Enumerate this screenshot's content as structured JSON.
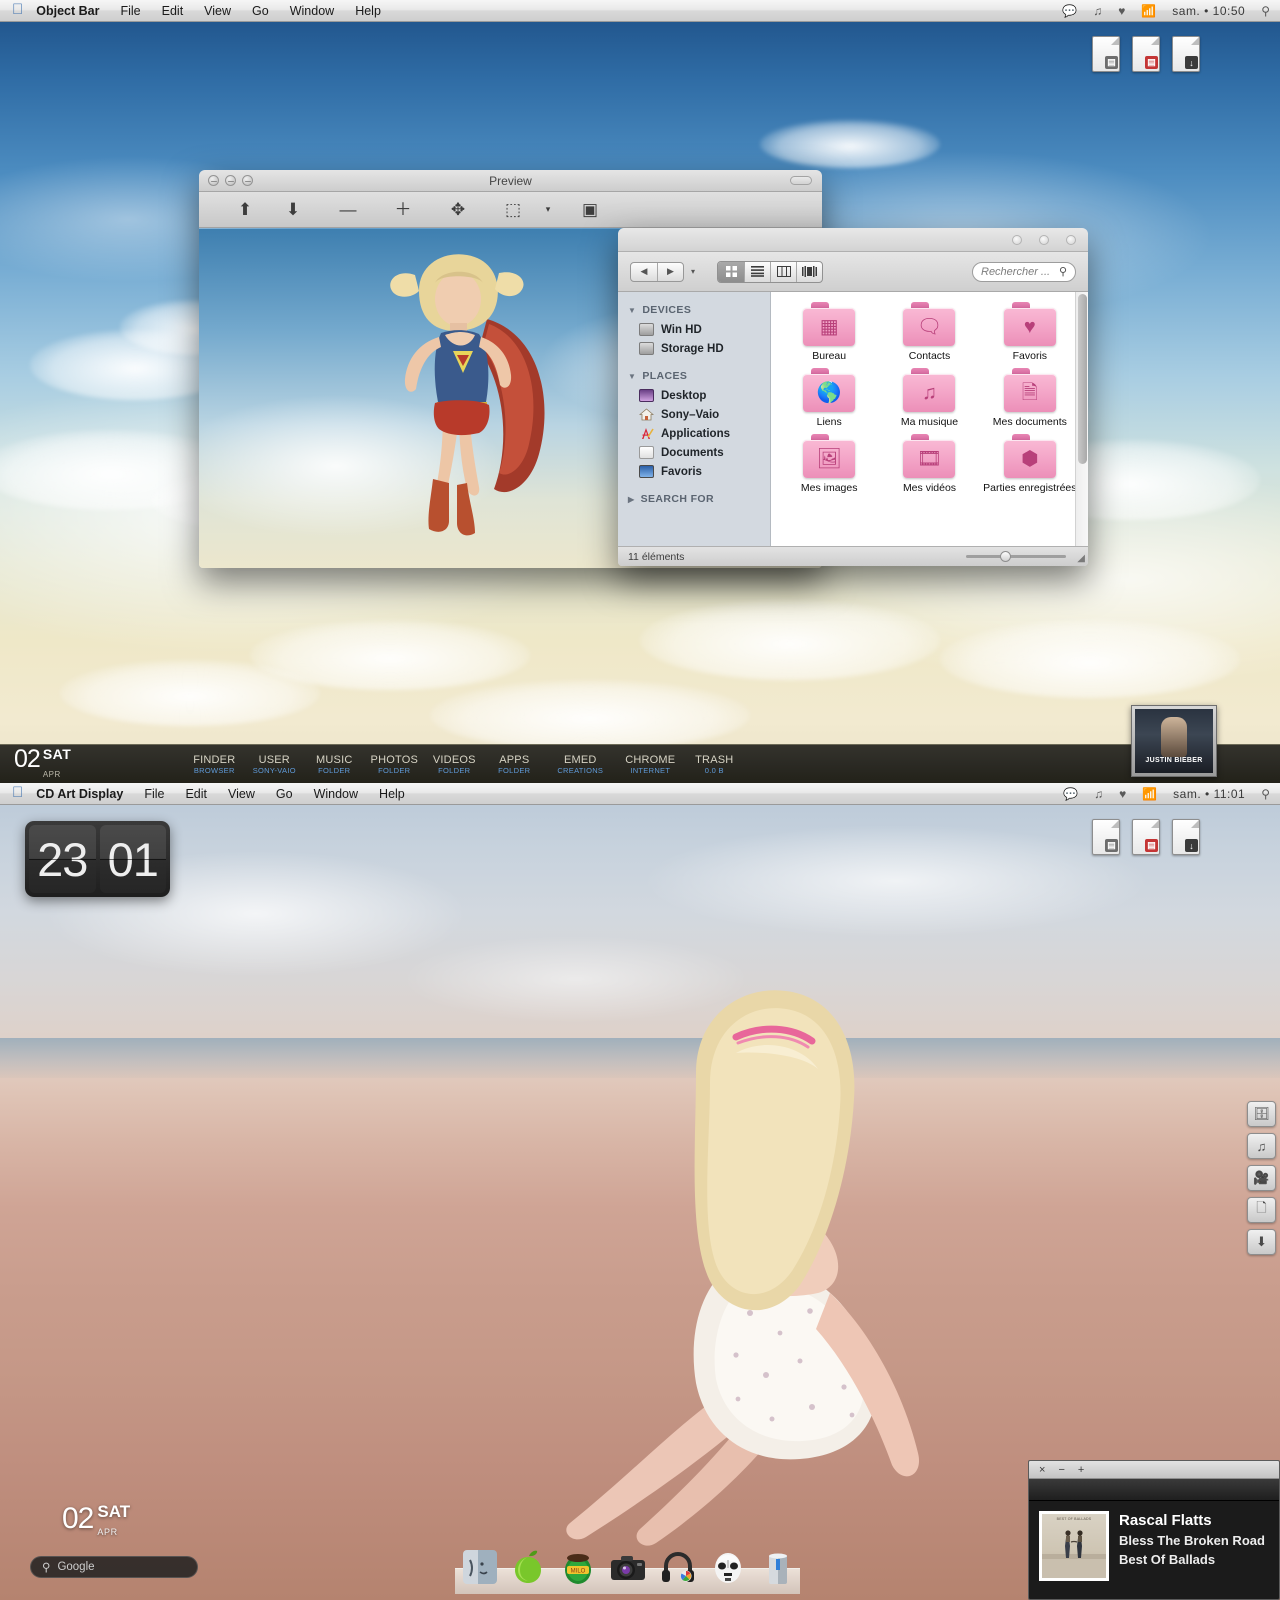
{
  "top_desktop": {
    "menubar": {
      "apple_icon": "apple-icon",
      "app_name": "Object Bar",
      "menus": [
        "File",
        "Edit",
        "View",
        "Go",
        "Window",
        "Help"
      ],
      "status_icons": [
        "speech-bubble-icon",
        "music-note-icon",
        "heart-icon",
        "rss-icon"
      ],
      "day": "sam.",
      "separator": "•",
      "clock": "10:50",
      "spotlight_icon": "search-icon"
    },
    "desktop_icons": [
      {
        "name": "document-icon-1",
        "badge": "▤",
        "badge_color": "#6d6d6d"
      },
      {
        "name": "document-icon-2",
        "badge": "▤",
        "badge_color": "#c43535"
      },
      {
        "name": "document-icon-3",
        "badge": "↓",
        "badge_color": "#3b3b3b"
      }
    ],
    "preview_window": {
      "title": "Preview",
      "toolbar_buttons": [
        {
          "name": "page-up-button",
          "glyph": "⬆"
        },
        {
          "name": "page-down-button",
          "glyph": "⬇"
        },
        {
          "name": "zoom-out-button",
          "glyph": "—"
        },
        {
          "name": "zoom-in-button",
          "glyph": "＋"
        },
        {
          "name": "move-tool-button",
          "glyph": "✥"
        },
        {
          "name": "select-tool-button",
          "glyph": "⬚"
        },
        {
          "name": "select-dropdown-button",
          "glyph": "▾"
        },
        {
          "name": "slideshow-button",
          "glyph": "▣"
        }
      ]
    },
    "finder_window": {
      "nav_back": "◀",
      "nav_forward": "▶",
      "nav_caret": "▾",
      "view_modes": [
        {
          "name": "icon-view-button",
          "glyph": "⠿",
          "active": true
        },
        {
          "name": "list-view-button",
          "glyph": "☰",
          "active": false
        },
        {
          "name": "column-view-button",
          "glyph": "▥",
          "active": false
        },
        {
          "name": "coverflow-view-button",
          "glyph": "|▮|",
          "active": false
        }
      ],
      "search_placeholder": "Rechercher ...",
      "search_icon": "magnifier-icon",
      "sidebar": [
        {
          "header": "DEVICES",
          "expanded": true,
          "items": [
            {
              "label": "Win HD",
              "icon": "harddisk-icon"
            },
            {
              "label": "Storage HD",
              "icon": "harddisk-icon"
            }
          ]
        },
        {
          "header": "PLACES",
          "expanded": true,
          "items": [
            {
              "label": "Desktop",
              "icon": "desktop-icon"
            },
            {
              "label": "Sony–Vaio",
              "icon": "home-icon"
            },
            {
              "label": "Applications",
              "icon": "applications-icon"
            },
            {
              "label": "Documents",
              "icon": "documents-icon"
            },
            {
              "label": "Favoris",
              "icon": "favorites-icon"
            }
          ]
        },
        {
          "header": "SEARCH FOR",
          "expanded": false,
          "items": []
        }
      ],
      "files": [
        {
          "label": "Bureau",
          "icon": "window-folder-icon",
          "glyph": "▤"
        },
        {
          "label": "Contacts",
          "icon": "contacts-folder-icon",
          "glyph": "💬"
        },
        {
          "label": "Favoris",
          "icon": "heart-folder-icon",
          "glyph": "♥"
        },
        {
          "label": "Liens",
          "icon": "globe-folder-icon",
          "glyph": "🌐"
        },
        {
          "label": "Ma musique",
          "icon": "music-folder-icon",
          "glyph": "♫"
        },
        {
          "label": "Mes documents",
          "icon": "document-folder-icon",
          "glyph": "🗎"
        },
        {
          "label": "Mes images",
          "icon": "pictures-folder-icon",
          "glyph": "🖼"
        },
        {
          "label": "Mes vidéos",
          "icon": "video-folder-icon",
          "glyph": "🎞"
        },
        {
          "label": "Parties enregistrées",
          "icon": "saved-games-folder-icon",
          "glyph": "📦"
        }
      ],
      "status": "11 éléments",
      "resize_icon": "resize-grip-icon"
    },
    "objectdock": {
      "date_day_number": "02",
      "date_weekday": "SAT",
      "date_month": "APR",
      "items": [
        {
          "title": "FINDER",
          "subtitle": "BROWSER"
        },
        {
          "title": "USER",
          "subtitle": "SONY-VAIO"
        },
        {
          "title": "MUSIC",
          "subtitle": "FOLDER"
        },
        {
          "title": "PHOTOS",
          "subtitle": "FOLDER"
        },
        {
          "title": "VIDEOS",
          "subtitle": "FOLDER"
        },
        {
          "title": "APPS",
          "subtitle": "FOLDER"
        },
        {
          "title": "EMED",
          "subtitle": "CREATIONS"
        },
        {
          "title": "CHROME",
          "subtitle": "INTERNET"
        },
        {
          "title": "TRASH",
          "subtitle": "0.0 B"
        }
      ]
    },
    "album_thumb": {
      "artist_text": "JUSTIN BIEBER"
    }
  },
  "bottom_desktop": {
    "menubar": {
      "apple_icon": "apple-icon",
      "app_name": "CD Art Display",
      "menus": [
        "File",
        "Edit",
        "View",
        "Go",
        "Window",
        "Help"
      ],
      "status_icons": [
        "speech-bubble-icon",
        "music-note-icon",
        "heart-icon",
        "rss-icon"
      ],
      "day": "sam.",
      "separator": "•",
      "clock": "11:01",
      "spotlight_icon": "search-icon"
    },
    "desktop_icons": [
      {
        "name": "document-icon-1",
        "badge": "▤",
        "badge_color": "#6d6d6d"
      },
      {
        "name": "document-icon-2",
        "badge": "▤",
        "badge_color": "#c43535"
      },
      {
        "name": "document-icon-3",
        "badge": "↓",
        "badge_color": "#3b3b3b"
      }
    ],
    "flip_clock": {
      "hours": "23",
      "minutes": "01"
    },
    "side_tray": [
      {
        "name": "screenshot-tray-icon",
        "glyph": "🖵"
      },
      {
        "name": "music-tray-icon",
        "glyph": "♫"
      },
      {
        "name": "video-tray-icon",
        "glyph": "🎥"
      },
      {
        "name": "copy-tray-icon",
        "glyph": "🗇"
      },
      {
        "name": "download-tray-icon",
        "glyph": "⬇"
      }
    ],
    "date_widget": {
      "day_number": "02",
      "weekday": "SAT",
      "month": "APR"
    },
    "search_widget": {
      "icon": "magnifier-icon",
      "placeholder": "Google"
    },
    "dock_icons": [
      {
        "name": "finder-dock-icon"
      },
      {
        "name": "apple-dock-icon"
      },
      {
        "name": "milo-dock-icon"
      },
      {
        "name": "camera-dock-icon"
      },
      {
        "name": "headphones-dock-icon"
      },
      {
        "name": "stormtrooper-dock-icon"
      },
      {
        "name": "trash-dock-icon"
      }
    ],
    "player": {
      "close_label": "×",
      "minimize_label": "−",
      "maximize_label": "+",
      "artist": "Rascal Flatts",
      "track": "Bless The Broken Road",
      "album": "Best Of Ballads"
    }
  }
}
